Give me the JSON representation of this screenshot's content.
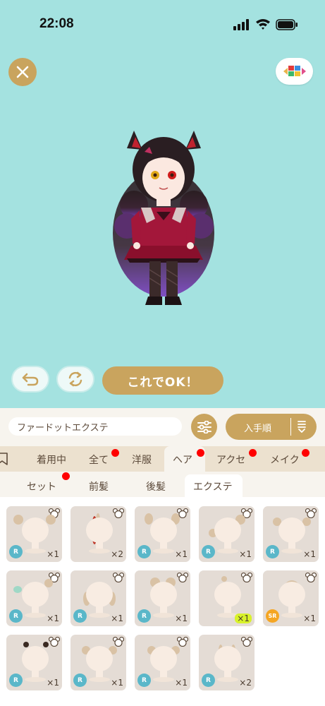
{
  "status_bar": {
    "time": "22:08"
  },
  "controls": {
    "ok_label": "これでOK！"
  },
  "search": {
    "value": "ファードットエクステ"
  },
  "sort": {
    "label": "入手順"
  },
  "tabs": [
    {
      "label": "着用中",
      "dot": false
    },
    {
      "label": "全て",
      "dot": true
    },
    {
      "label": "洋服",
      "dot": false
    },
    {
      "label": "ヘア",
      "dot": true,
      "active": true
    },
    {
      "label": "アクセ",
      "dot": true
    },
    {
      "label": "メイク",
      "dot": true
    }
  ],
  "subtabs": [
    {
      "label": "セット",
      "dot": true
    },
    {
      "label": "前髪",
      "dot": false
    },
    {
      "label": "後髪",
      "dot": false
    },
    {
      "label": "エクステ",
      "dot": false,
      "active": true
    }
  ],
  "items": [
    {
      "rarity": "R",
      "count": "×1"
    },
    {
      "rarity": "",
      "count": "×2"
    },
    {
      "rarity": "R",
      "count": "×1"
    },
    {
      "rarity": "R",
      "count": "×1"
    },
    {
      "rarity": "R",
      "count": "×1"
    },
    {
      "rarity": "R",
      "count": "×1"
    },
    {
      "rarity": "R",
      "count": "×1"
    },
    {
      "rarity": "R",
      "count": "×1"
    },
    {
      "rarity": "",
      "count": "×1"
    },
    {
      "rarity": "SR",
      "count": "×1"
    },
    {
      "rarity": "R",
      "count": "×1"
    },
    {
      "rarity": "R",
      "count": "×1"
    },
    {
      "rarity": "R",
      "count": "×1"
    },
    {
      "rarity": "R",
      "count": "×2"
    }
  ],
  "colors": {
    "background": "#a4e2e0",
    "accent": "#c9a45e",
    "tab_bar": "#ece1cf",
    "badge_r": "#5ab7c9",
    "badge_sr": "#f5a623",
    "notify_dot": "#ff0000"
  }
}
